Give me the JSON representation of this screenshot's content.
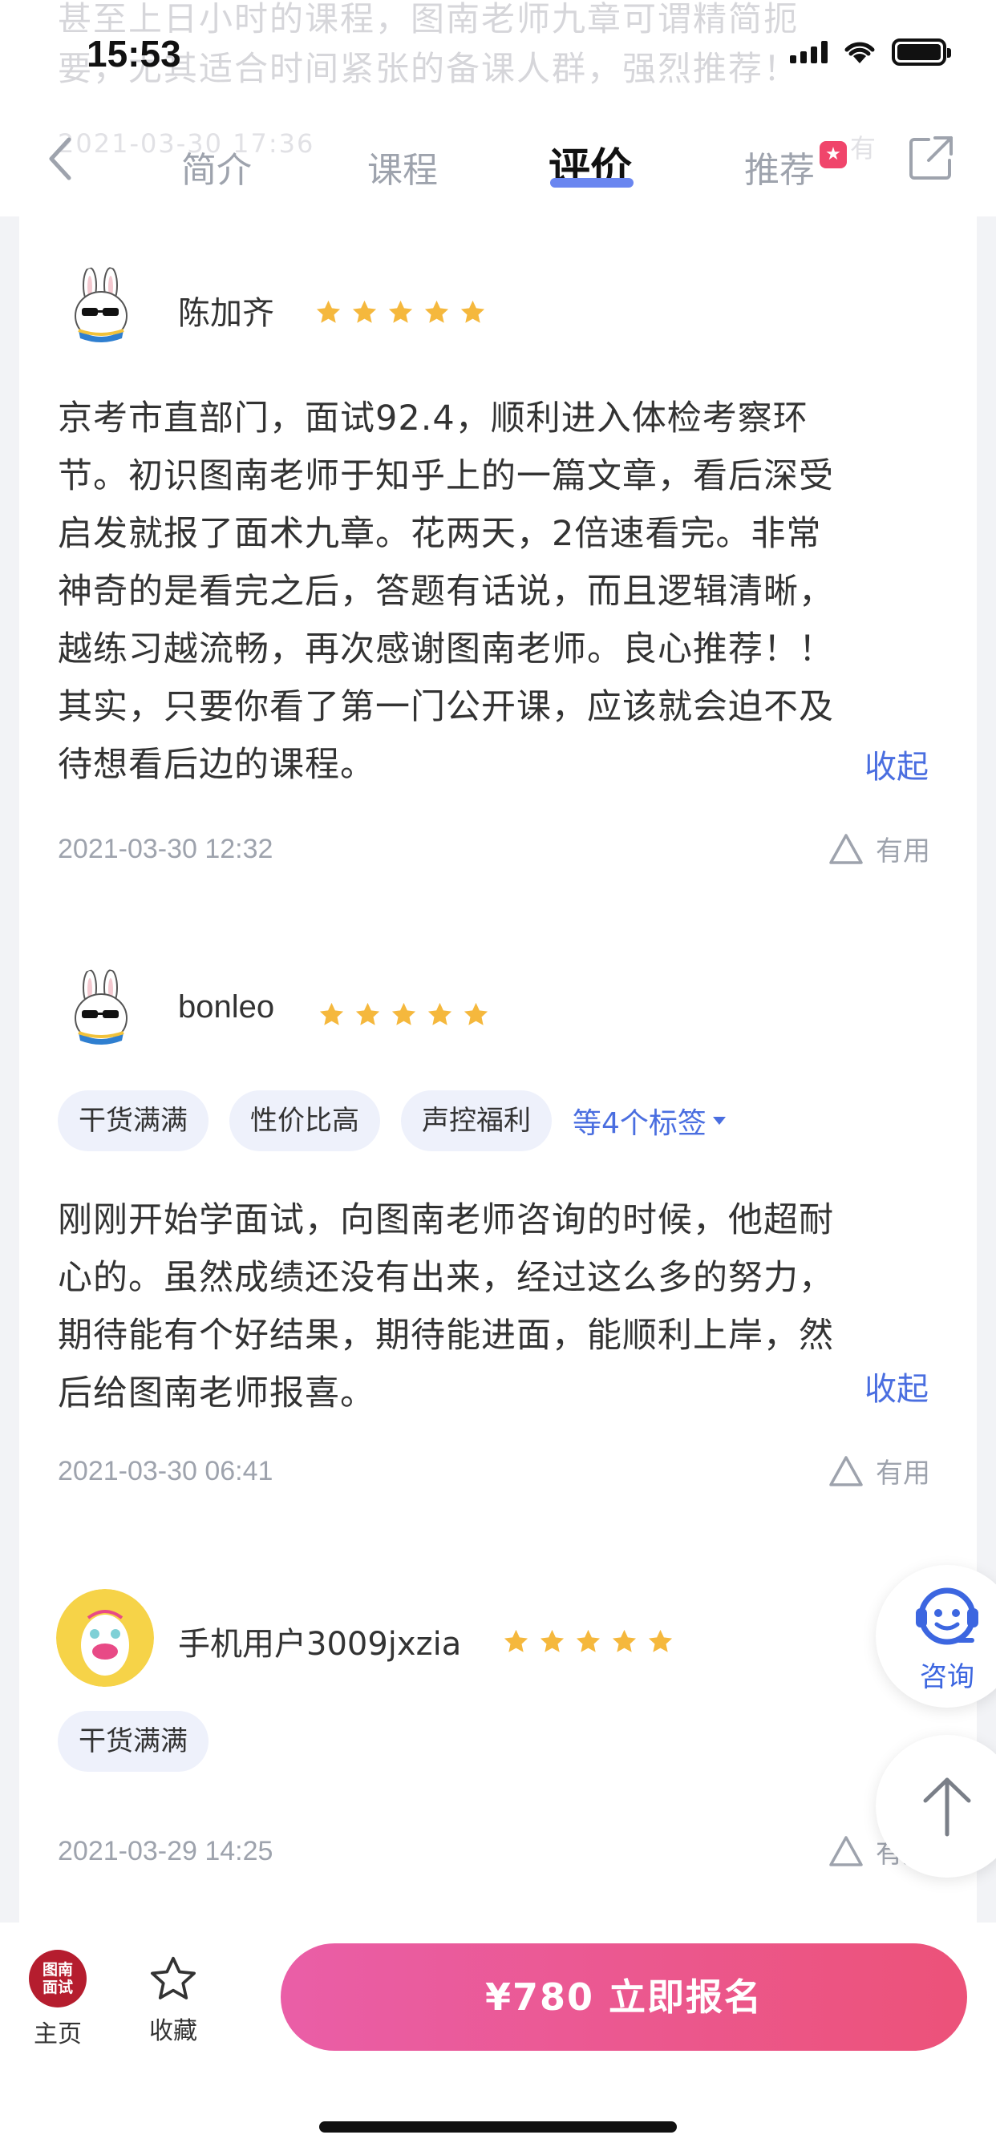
{
  "status_bar": {
    "time": "15:53"
  },
  "background_text": {
    "line1": "甚至上日小时的课程，图南老师九章可谓精简扼",
    "line2": "要，尤其适合时间紧张的备课人群，强烈推荐！",
    "line3": "2021-03-30 17:36",
    "line4": "有"
  },
  "nav": {
    "tabs": [
      {
        "label": "简介"
      },
      {
        "label": "课程"
      },
      {
        "label": "评价"
      },
      {
        "label": "推荐"
      }
    ],
    "active_tab": "评价",
    "badge_symbol": "★"
  },
  "reviews": [
    {
      "username": "陈加齐",
      "rating": 5,
      "text_lines": [
        "京考市直部门，面试92.4，顺利进入体检考察环",
        "节。初识图南老师于知乎上的一篇文章，看后深受",
        "启发就报了面术九章。花两天，2倍速看完。非常",
        "神奇的是看完之后，答题有话说，而且逻辑清晰，",
        "越练习越流畅，再次感谢图南老师。良心推荐！！",
        "其实，只要你看了第一门公开课，应该就会迫不及",
        "待想看后边的课程。"
      ],
      "collapse": "收起",
      "date": "2021-03-30 12:32",
      "useful": "有用"
    },
    {
      "username": "bonleo",
      "rating": 5,
      "tags": [
        "干货满满",
        "性价比高",
        "声控福利"
      ],
      "more_tags": "等4个标签",
      "text_lines": [
        "刚刚开始学面试，向图南老师咨询的时候，他超耐",
        "心的。虽然成绩还没有出来，经过这么多的努力，",
        "期待能有个好结果，期待能进面，能顺利上岸，然",
        "后给图南老师报喜。"
      ],
      "collapse": "收起",
      "date": "2021-03-30 06:41",
      "useful": "有用"
    },
    {
      "username": "手机用户3009jxzia",
      "rating": 5,
      "tags": [
        "干货满满"
      ],
      "date": "2021-03-29 14:25",
      "useful": "有用"
    }
  ],
  "floating": {
    "consult_label": "咨询"
  },
  "bottom_bar": {
    "home_logo_line1": "图南",
    "home_logo_line2": "面试",
    "home_label": "主页",
    "favorite_label": "收藏",
    "enroll_label": "¥780  立即报名"
  },
  "colors": {
    "accent_blue": "#4a6ee0",
    "tab_underline": "#6a86f0",
    "star": "#f5b83d",
    "enroll_start": "#ea5ea7",
    "enroll_end": "#ec5279",
    "tag_bg": "#eef1fb"
  }
}
